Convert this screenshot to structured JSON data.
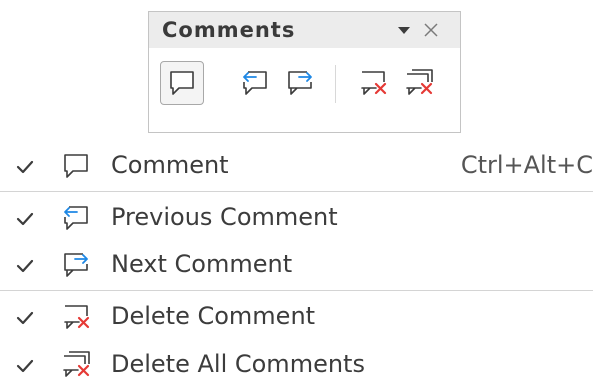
{
  "toolbar": {
    "title": "Comments",
    "buttons": [
      {
        "name": "comment-button",
        "icon": "comment-icon",
        "active": true
      },
      {
        "name": "previous-comment-button",
        "icon": "previous-comment-icon"
      },
      {
        "name": "next-comment-button",
        "icon": "next-comment-icon"
      },
      {
        "name": "delete-comment-button",
        "icon": "delete-comment-icon"
      },
      {
        "name": "delete-all-comments-button",
        "icon": "delete-all-comments-icon"
      }
    ]
  },
  "menu": {
    "items": [
      {
        "label": "Comment",
        "shortcut": "Ctrl+Alt+C",
        "checked": true,
        "icon": "comment-icon"
      },
      {
        "label": "Previous Comment",
        "checked": true,
        "icon": "previous-comment-icon"
      },
      {
        "label": "Next Comment",
        "checked": true,
        "icon": "next-comment-icon"
      },
      {
        "label": "Delete Comment",
        "checked": true,
        "icon": "delete-comment-icon"
      },
      {
        "label": "Delete All Comments",
        "checked": true,
        "icon": "delete-all-comments-icon"
      }
    ]
  },
  "colors": {
    "icon_stroke": "#3c3c3c",
    "arrow_blue": "#1e88e5",
    "delete_red": "#e53935"
  }
}
